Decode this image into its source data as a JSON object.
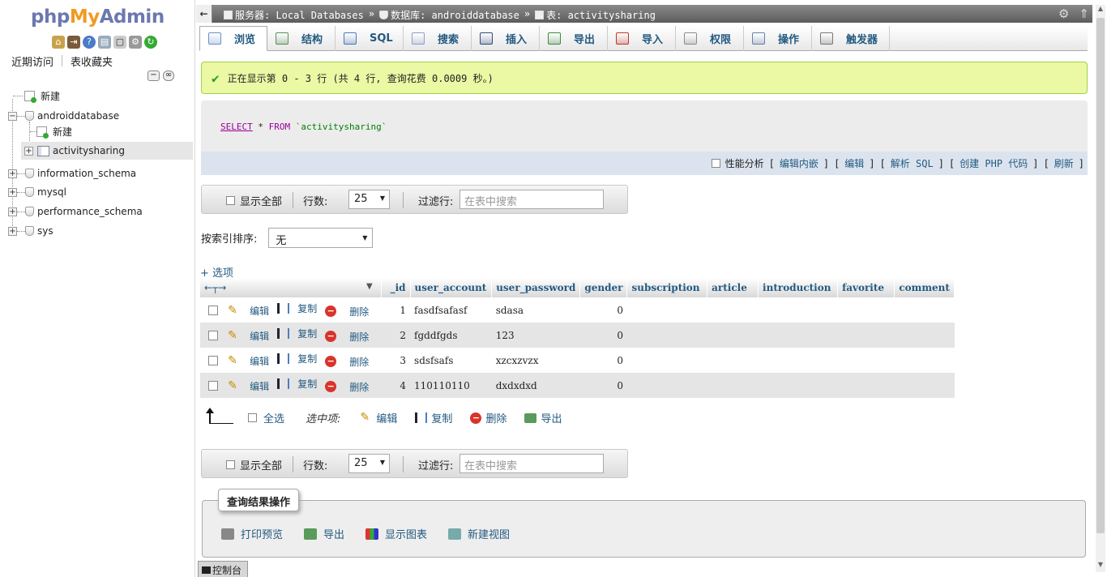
{
  "logo": {
    "php": "php",
    "my": "My",
    "admin": "Admin"
  },
  "nav_tabs": {
    "recent": "近期访问",
    "favorites": "表收藏夹"
  },
  "tree": {
    "new": "新建",
    "db_android": "androiddatabase",
    "db_android_new": "新建",
    "table_active": "activitysharing",
    "db_info": "information_schema",
    "db_mysql": "mysql",
    "db_perf": "performance_schema",
    "db_sys": "sys"
  },
  "breadcrumb": {
    "server": "服务器: Local Databases",
    "database": "数据库: androiddatabase",
    "table": "表: activitysharing",
    "sep": "»"
  },
  "menu": [
    {
      "label": "浏览",
      "icon": "browse-icon",
      "color": "#6a8fc7"
    },
    {
      "label": "结构",
      "icon": "structure-icon",
      "color": "#5a8c5a"
    },
    {
      "label": "SQL",
      "icon": "sql-icon",
      "color": "#4b78b5"
    },
    {
      "label": "搜索",
      "icon": "search-icon",
      "color": "#8aa0c8"
    },
    {
      "label": "插入",
      "icon": "insert-icon",
      "color": "#344a7a"
    },
    {
      "label": "导出",
      "icon": "export-icon",
      "color": "#3f8a3f"
    },
    {
      "label": "导入",
      "icon": "import-icon",
      "color": "#c0392b"
    },
    {
      "label": "权限",
      "icon": "privileges-icon",
      "color": "#8a8a8a"
    },
    {
      "label": "操作",
      "icon": "wrench-icon",
      "color": "#6a7fa8"
    },
    {
      "label": "触发器",
      "icon": "triggers-icon",
      "color": "#777777"
    }
  ],
  "success_message": "正在显示第 0 - 3 行 (共 4 行, 查询花费 0.0009 秒。)",
  "sql": {
    "select": "SELECT",
    "star": " * ",
    "from": "FROM",
    "table": " `activitysharing`"
  },
  "sql_footer": {
    "profiling": "性能分析",
    "edit_inline": "编辑内嵌",
    "edit": "编辑",
    "explain": "解析 SQL",
    "create_php": "创建 PHP 代码",
    "refresh": "刷新",
    "lb": "[",
    "rb": "]"
  },
  "navbar": {
    "show_all": "显示全部",
    "rows_label": "行数:",
    "rows_value": "25",
    "filter_label": "过滤行:",
    "filter_placeholder": "在表中搜索"
  },
  "sort": {
    "label": "按索引排序:",
    "value": "无"
  },
  "options_link": "+ 选项",
  "table": {
    "columns": [
      "_id",
      "user_account",
      "user_password",
      "gender",
      "subscription",
      "article",
      "introduction",
      "favorite",
      "comment"
    ],
    "actions": {
      "edit": "编辑",
      "copy": "复制",
      "delete": "删除"
    },
    "rows": [
      {
        "id": "1",
        "account": "fasdfsafasf",
        "password": "sdasa",
        "gender": "0"
      },
      {
        "id": "2",
        "account": "fgddfgds",
        "password": "123",
        "gender": "0"
      },
      {
        "id": "3",
        "account": "sdsfsafs",
        "password": "xzcxzvzx",
        "gender": "0"
      },
      {
        "id": "4",
        "account": "110110110",
        "password": "dxdxdxd",
        "gender": "0"
      }
    ]
  },
  "with_selected": {
    "check_all": "全选",
    "label": "选中项:",
    "edit": "编辑",
    "copy": "复制",
    "delete": "删除",
    "export": "导出"
  },
  "query_ops": {
    "legend": "查询结果操作",
    "print": "打印预览",
    "export": "导出",
    "chart": "显示图表",
    "create_view": "新建视图"
  },
  "console": "控制台"
}
